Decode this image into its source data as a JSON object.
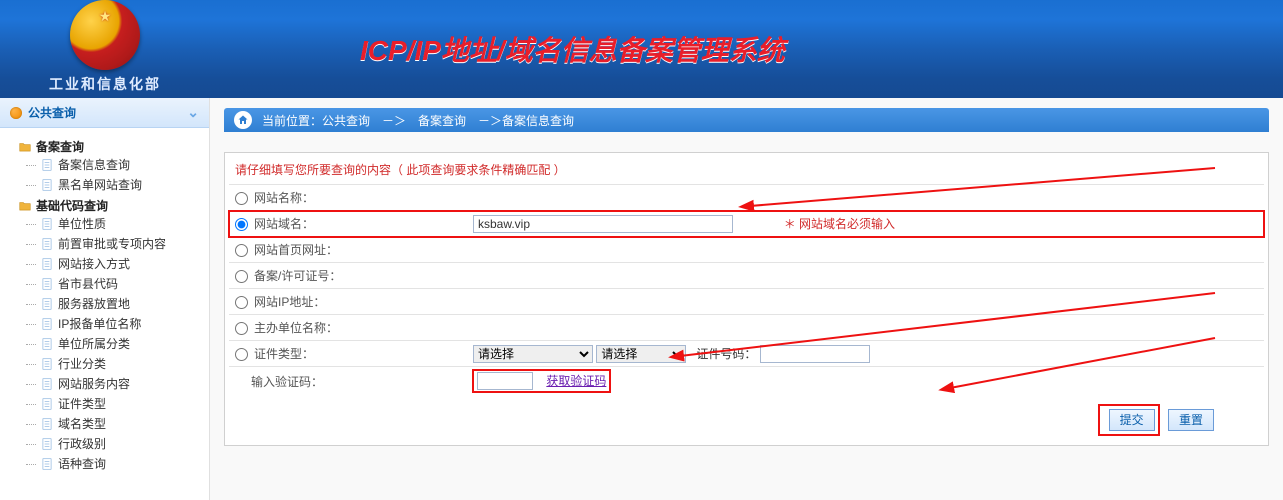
{
  "header": {
    "org": "工业和信息化部",
    "title": "ICP/IP地址/域名信息备案管理系统"
  },
  "sidebar": {
    "section_title": "公共查询",
    "groups": [
      {
        "label": "备案查询",
        "items": [
          "备案信息查询",
          "黑名单网站查询"
        ]
      },
      {
        "label": "基础代码查询",
        "items": [
          "单位性质",
          "前置审批或专项内容",
          "网站接入方式",
          "省市县代码",
          "服务器放置地",
          "IP报备单位名称",
          "单位所属分类",
          "行业分类",
          "网站服务内容",
          "证件类型",
          "域名类型",
          "行政级别",
          "语种查询"
        ]
      }
    ]
  },
  "breadcrumb": {
    "prefix": "当前位置：",
    "items": [
      "公共查询",
      "备案查询",
      "备案信息查询"
    ],
    "sep": "－＞"
  },
  "form": {
    "instruction": "请仔细填写您所要查询的内容（ 此项查询要求条件精确匹配 ）",
    "rows": {
      "site_name": {
        "label": "网站名称："
      },
      "domain": {
        "label": "网站域名：",
        "value": "ksbaw.vip",
        "note": "＊ 网站域名必须输入"
      },
      "homepage": {
        "label": "网站首页网址："
      },
      "license": {
        "label": "备案/许可证号："
      },
      "ip": {
        "label": "网站IP地址："
      },
      "sponsor": {
        "label": "主办单位名称："
      },
      "cert_type": {
        "label": "证件类型：",
        "placeholder": "请选择",
        "id_label": "证件号码："
      },
      "captcha": {
        "label": "输入验证码：",
        "link": "获取验证码"
      }
    },
    "buttons": {
      "submit": "提交",
      "reset": "重置"
    }
  }
}
